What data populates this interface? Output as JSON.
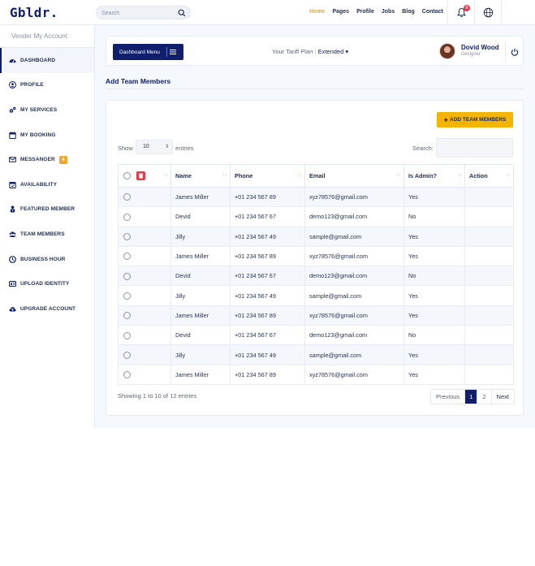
{
  "app": {
    "logo": "Gbldr."
  },
  "header": {
    "search_placeholder": "Search",
    "nav": [
      "Home",
      "Pages",
      "Profile",
      "Jobs",
      "Blog",
      "Contact"
    ],
    "active_nav": "Home",
    "notification_count": "0"
  },
  "sidebar": {
    "title": "Vender My Account",
    "items": [
      {
        "label": "DASHBOARD",
        "icon": "dashboard-icon",
        "active": true
      },
      {
        "label": "PROFILE",
        "icon": "user-icon"
      },
      {
        "label": "MY SERVICES",
        "icon": "gears-icon"
      },
      {
        "label": "MY BOOKING",
        "icon": "calendar-icon"
      },
      {
        "label": "MESSANGER",
        "icon": "envelope-icon",
        "badge": "4"
      },
      {
        "label": "AVAILABILITY",
        "icon": "calendar-check-icon"
      },
      {
        "label": "FEATURED MEMBER",
        "icon": "user-lock-icon"
      },
      {
        "label": "TEAM MEMBERS",
        "icon": "users-icon"
      },
      {
        "label": "BUSINESS HOUR",
        "icon": "clock-icon"
      },
      {
        "label": "UPLOAD IDENTITY",
        "icon": "id-card-icon"
      },
      {
        "label": "UPGRADE ACCOUNT",
        "icon": "cloud-upload-icon"
      }
    ]
  },
  "dashbar": {
    "menu_label": "Dashboard Menu",
    "tariff_label": "Your Tariff Plan :",
    "tariff_value": "Extended",
    "user_name": "Dovid Wood",
    "user_role": "Designer"
  },
  "page": {
    "title": "Add Team Members",
    "add_button": "ADD TEAM MEMBERS",
    "show_label": "Show",
    "show_value": "10",
    "entries_label": "entries",
    "search_label": "Search:"
  },
  "table": {
    "columns": [
      "",
      "Name",
      "Phone",
      "Email",
      "Is Admin?",
      "Action"
    ],
    "rows": [
      {
        "name": "James Miller",
        "phone": "+01 234 567 89",
        "email": "xyz78576@gmail.com",
        "admin": "Yes"
      },
      {
        "name": "Devid",
        "phone": "+01 234 567 67",
        "email": "demo123@gmail.com",
        "admin": "No"
      },
      {
        "name": "Jilly",
        "phone": "+01 234 567 49",
        "email": "sample@gmail.com",
        "admin": "Yes"
      },
      {
        "name": "James Miller",
        "phone": "+01 234 567 89",
        "email": "xyz78576@gmail.com",
        "admin": "Yes"
      },
      {
        "name": "Devid",
        "phone": "+01 234 567 67",
        "email": "demo123@gmail.com",
        "admin": "No"
      },
      {
        "name": "Jilly",
        "phone": "+01 234 567 49",
        "email": "sample@gmail.com",
        "admin": "Yes"
      },
      {
        "name": "James Miller",
        "phone": "+01 234 567 89",
        "email": "xyz78576@gmail.com",
        "admin": "Yes"
      },
      {
        "name": "Devid",
        "phone": "+01 234 567 67",
        "email": "demo123@gmail.com",
        "admin": "No"
      },
      {
        "name": "Jilly",
        "phone": "+01 234 567 49",
        "email": "sample@gmail.com",
        "admin": "Yes"
      },
      {
        "name": "James Miller",
        "phone": "+01 234 567 89",
        "email": "xyz78576@gmail.com",
        "admin": "Yes"
      }
    ]
  },
  "footer": {
    "showing": "Showing 1 to 10 of 12 entries",
    "pagination": [
      "Previous",
      "1",
      "2",
      "Next"
    ],
    "active_page": "1"
  },
  "colors": {
    "brand": "#0f1f6b",
    "accent": "#f5b400",
    "active_nav": "#f5a623",
    "danger": "#e63946"
  }
}
